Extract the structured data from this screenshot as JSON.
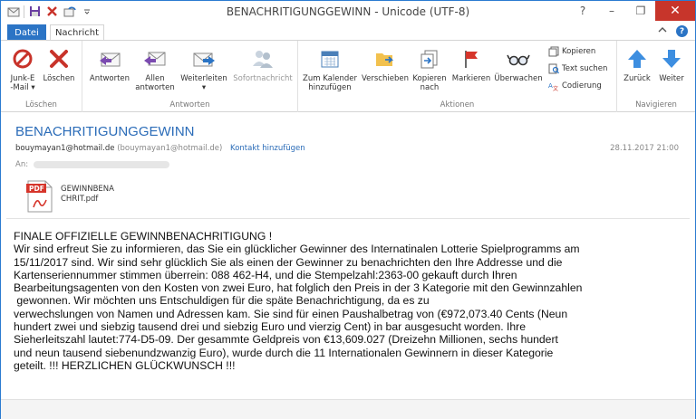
{
  "window": {
    "title": "BENACHRITIGUNGGEWINN - Unicode (UTF-8)",
    "controls": {
      "help": "?",
      "minimize": "–",
      "restore": "❐",
      "close": "✕"
    }
  },
  "tabs": {
    "file": "Datei",
    "message": "Nachricht"
  },
  "ribbon": {
    "groups": {
      "delete": "Löschen",
      "respond": "Antworten",
      "actions": "Aktionen",
      "navigate": "Navigieren"
    },
    "buttons": {
      "junk": "Junk-E\n-Mail ▾",
      "delete": "Löschen",
      "reply": "Antworten",
      "reply_all": "Allen\nantworten",
      "forward": "Weiterleiten\n▾",
      "im": "Sofortnachricht",
      "calendar": "Zum Kalender\nhinzufügen",
      "move": "Verschieben",
      "copy_to": "Kopieren\nnach",
      "flag": "Markieren",
      "monitor": "Überwachen",
      "copy": "Kopieren",
      "find": "Text suchen",
      "encoding": "Codierung",
      "back": "Zurück",
      "next": "Weiter"
    }
  },
  "header": {
    "subject": "BENACHRITIGUNGGEWINN",
    "from_email": "bouymayan1@hotmail.de",
    "from_display": "(bouymayan1@hotmail.de)",
    "add_contact": "Kontakt hinzufügen",
    "date": "28.11.2017 21:00",
    "to_label": "An:",
    "attachment": {
      "name": "GEWINNBENA\nCHRIT.pdf",
      "icon_label": "PDF"
    }
  },
  "body": {
    "text": "FINALE OFFIZIELLE GEWINNBENACHRITIGUNG !\nWir sind erfreut Sie zu informieren, das Sie ein glücklicher Gewinner des Internatinalen Lotterie Spielprogramms am\n15/11/2017 sind. Wir sind sehr glücklich Sie als einen der Gewinner zu benachrichten den Ihre Addresse und die\nKartenseriennummer stimmen überrein: 088 462-H4, und die Stempelzahl:2363-00 gekauft durch Ihren\nBearbeitungsagenten von den Kosten von zwei Euro, hat folglich den Preis in der 3 Kategorie mit den Gewinnzahlen\n gewonnen. Wir möchten uns Entschuldigen für die späte Benachrichtigung, da es zu\nverwechslungen von Namen und Adressen kam. Sie sind für einen Paushalbetrag von (€972,073.40 Cents (Neun\nhundert zwei und siebzig tausend drei und siebzig Euro und vierzig Cent) in bar ausgesucht worden. Ihre\nSieherleitszahl lautet:774-D5-09. Der gesammte Geldpreis von €13,609.027 (Dreizehn Millionen, sechs hundert\nund neun tausend siebenundzwanzig Euro), wurde durch die 11 Internationalen Gewinnern in dieser Kategorie\ngeteilt. !!! HERZLICHEN GLÜCKWUNSCH !!!"
  }
}
